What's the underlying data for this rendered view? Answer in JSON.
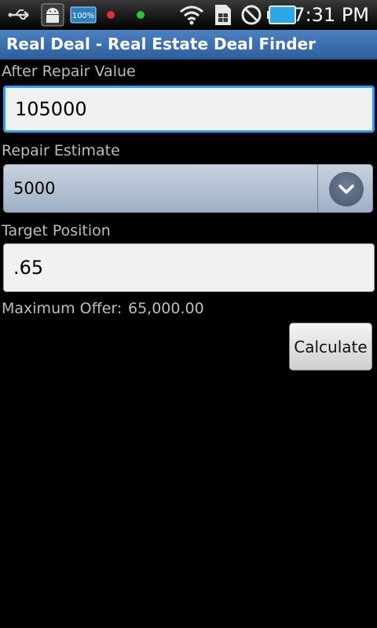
{
  "status_bar": {
    "time": "7:31 PM",
    "battery_badge": "100%",
    "icons": [
      "usb-icon",
      "android-debug-icon",
      "battery-badge-icon",
      "red-dot-icon",
      "green-dot-icon",
      "wifi-icon",
      "sim-card-icon",
      "no-signal-icon",
      "battery-icon"
    ]
  },
  "app": {
    "title": "Real Deal - Real Estate Deal Finder"
  },
  "fields": {
    "after_repair_value": {
      "label": "After Repair Value",
      "value": "105000"
    },
    "repair_estimate": {
      "label": "Repair Estimate",
      "selected": "5000"
    },
    "target_position": {
      "label": "Target Position",
      "value": ".65"
    }
  },
  "result": {
    "label": "Maximum Offer:",
    "value": "65,000.00"
  },
  "actions": {
    "calculate_label": "Calculate"
  },
  "colors": {
    "title_bar": "#3e72b2",
    "focus_border": "#2f9cf0",
    "background": "#000000"
  }
}
